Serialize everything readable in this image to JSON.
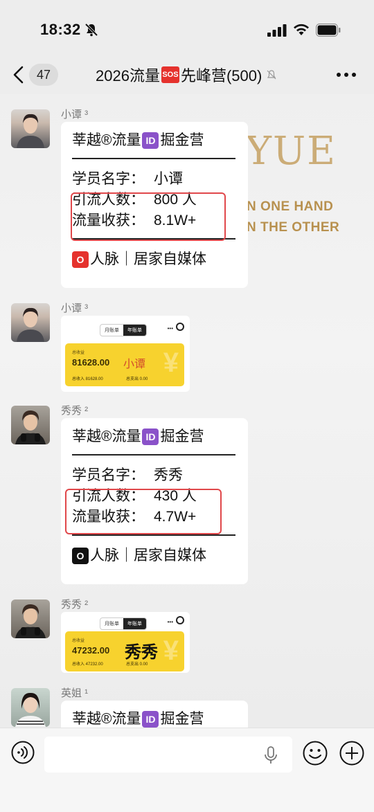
{
  "status_bar": {
    "time": "18:32"
  },
  "nav": {
    "unread_count": "47",
    "title_prefix": "2026流量",
    "title_emoji": "SOS",
    "title_suffix": "先峰营(500)"
  },
  "background": {
    "logo": "YUE",
    "line1": "N ONE HAND",
    "line2": "N THE OTHER"
  },
  "messages": [
    {
      "sender": "小谭 ³",
      "type": "text",
      "header": "莘越®流量",
      "id_emoji": "ID",
      "header_suffix": "掘金营",
      "name_label": "学员名字：",
      "name_value": "小谭",
      "traffic_label": "引流人数：",
      "traffic_value": "800 人",
      "gain_label": "流量收获：",
      "gain_value": "8.1W+",
      "footer_emoji": "O",
      "footer": "人脉｜居家自媒体"
    },
    {
      "sender": "小谭 ³",
      "type": "image",
      "tab1": "月账单",
      "tab2": "年账单",
      "label": "总收益",
      "amount": "81628.00",
      "name": "小谭",
      "sub1": "总收入 81628.00",
      "sub2": "总支出 0.00"
    },
    {
      "sender": "秀秀 ²",
      "type": "text",
      "header": "莘越®流量",
      "id_emoji": "ID",
      "header_suffix": "掘金营",
      "name_label": "学员名字：",
      "name_value": "秀秀",
      "traffic_label": "引流人数：",
      "traffic_value": "430 人",
      "gain_label": "流量收获：",
      "gain_value": "4.7W+",
      "footer_emoji": "O",
      "footer": "人脉｜居家自媒体"
    },
    {
      "sender": "秀秀 ²",
      "type": "image",
      "tab1": "月账单",
      "tab2": "年账单",
      "label": "总收益",
      "amount": "47232.00",
      "name": "秀秀",
      "sub1": "总收入 47232.00",
      "sub2": "总支出 0.00"
    },
    {
      "sender": "英姐 ¹",
      "type": "text",
      "header": "莘越®流量",
      "id_emoji": "ID",
      "header_suffix": "掘金营"
    }
  ],
  "input": {
    "placeholder": ""
  }
}
